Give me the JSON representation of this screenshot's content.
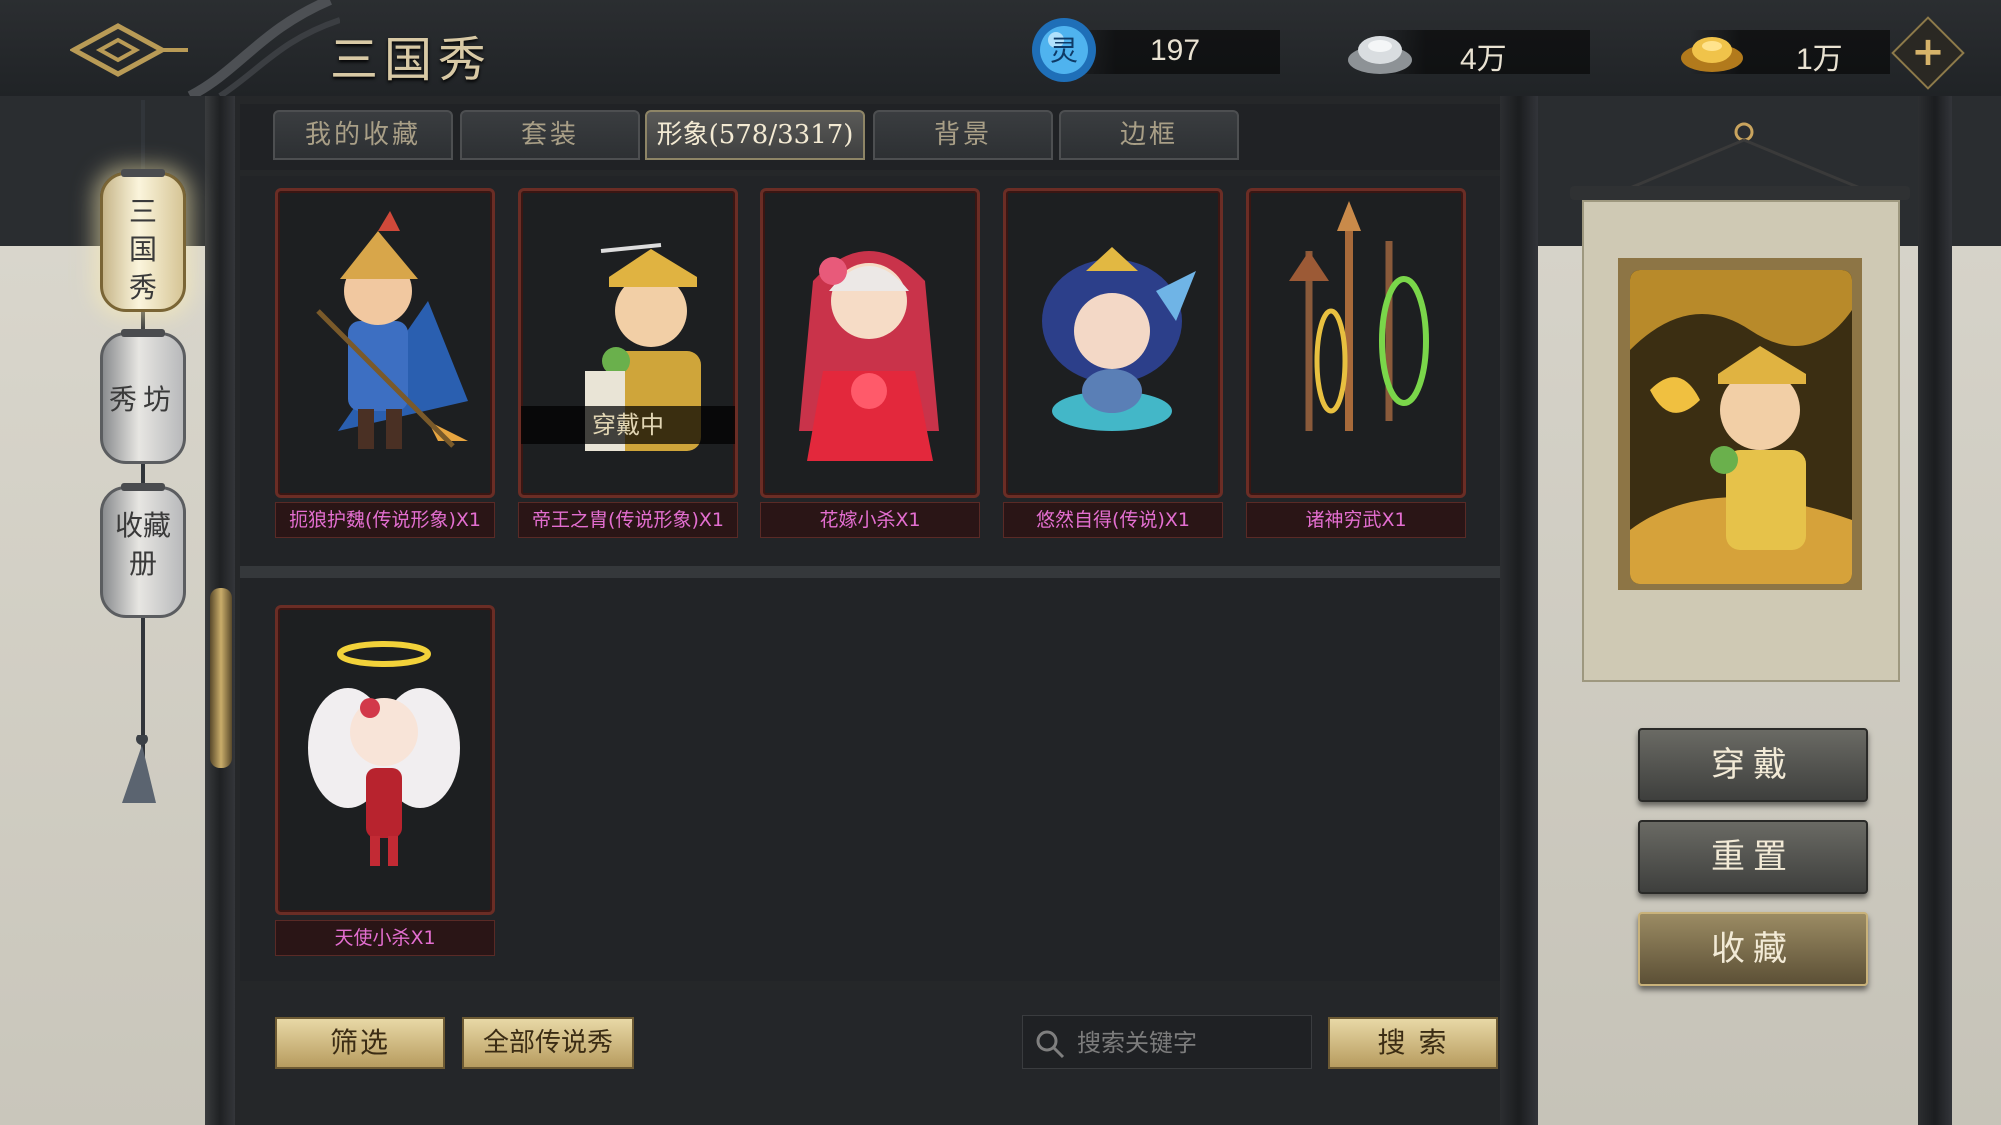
{
  "header": {
    "title": "三国秀",
    "resources": [
      {
        "icon": "spirit-orb-icon",
        "value": "197"
      },
      {
        "icon": "silver-ingot-icon",
        "value": "4万"
      },
      {
        "icon": "gold-ingot-icon",
        "value": "1万"
      }
    ],
    "plus_icon": "plus-icon"
  },
  "sidebar": {
    "items": [
      {
        "label": "三国秀",
        "active": true
      },
      {
        "label": "秀坊",
        "active": false
      },
      {
        "label": "收藏册",
        "active": false
      }
    ]
  },
  "tabs": [
    {
      "label": "我的收藏",
      "active": false
    },
    {
      "label": "套装",
      "active": false
    },
    {
      "label": "形象(578/3317)",
      "active": true
    },
    {
      "label": "背景",
      "active": false
    },
    {
      "label": "边框",
      "active": false
    }
  ],
  "cards": [
    {
      "name": "扼狼护魏(传说形象)X1",
      "wearing": false
    },
    {
      "name": "帝王之胄(传说形象)X1",
      "wearing": true,
      "wearing_label": "穿戴中"
    },
    {
      "name": "花嫁小杀X1",
      "wearing": false
    },
    {
      "name": "悠然自得(传说)X1",
      "wearing": false
    },
    {
      "name": "诸神穷武X1",
      "wearing": false
    },
    {
      "name": "天使小杀X1",
      "wearing": false
    }
  ],
  "bottom": {
    "filter_label": "筛选",
    "legend_label": "全部传说秀",
    "search_placeholder": "搜索关键字",
    "search_label": "搜 索"
  },
  "actions": {
    "wear_label": "穿戴",
    "reset_label": "重置",
    "collect_label": "收藏"
  },
  "colors": {
    "card_border": "#6b2d25",
    "card_name": "#e36ed0",
    "gold_button": "#d4bd82"
  }
}
